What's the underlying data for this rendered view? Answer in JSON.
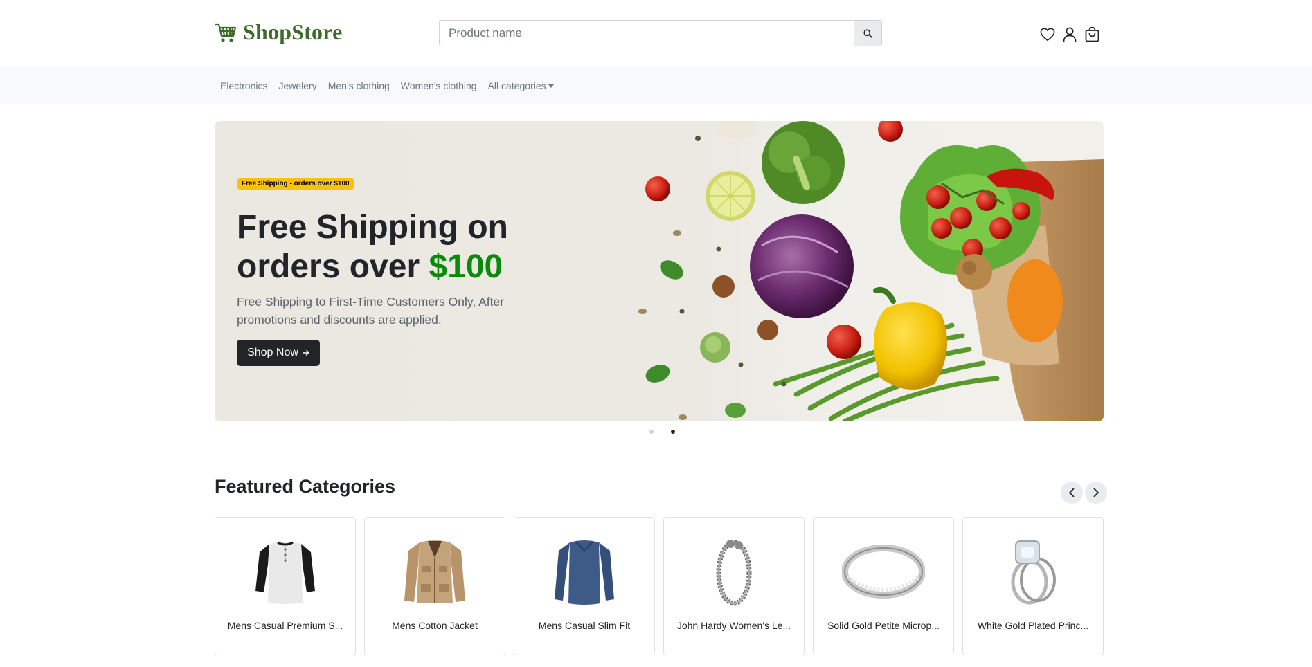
{
  "header": {
    "logo_text": "ShopStore",
    "logo_icon": "shopping-cart-icon",
    "search": {
      "placeholder": "Product name",
      "value": ""
    },
    "icons": [
      "heart-icon",
      "user-icon",
      "shopping-bag-icon"
    ],
    "brand_color": "#3f6b2a"
  },
  "nav": {
    "items": [
      "Electronics",
      "Jewelery",
      "Men's clothing",
      "Women's clothing"
    ],
    "dropdown_label": "All categories"
  },
  "hero": {
    "badge": "Free Shipping - orders over $100",
    "title_part1": "Free Shipping on orders over ",
    "title_accent": "$100",
    "subtitle": "Free Shipping to First-Time Customers Only, After promotions and discounts are applied.",
    "button_label": "Shop Now",
    "button_icon": "arrow-right-icon",
    "accent_color": "#0a8a0a",
    "badge_color": "#ffc107",
    "slides": 2,
    "active_slide": 2
  },
  "featured": {
    "title": "Featured Categories",
    "items": [
      {
        "label": "Mens Casual Premium S...",
        "icon": "henley-shirt-image"
      },
      {
        "label": "Mens Cotton Jacket",
        "icon": "jacket-image"
      },
      {
        "label": "Mens Casual Slim Fit",
        "icon": "long-sleeve-shirt-image"
      },
      {
        "label": "John Hardy Women's Le...",
        "icon": "bracelet-image"
      },
      {
        "label": "Solid Gold Petite Microp...",
        "icon": "ring-image"
      },
      {
        "label": "White Gold Plated Princ...",
        "icon": "engagement-ring-image"
      }
    ]
  }
}
